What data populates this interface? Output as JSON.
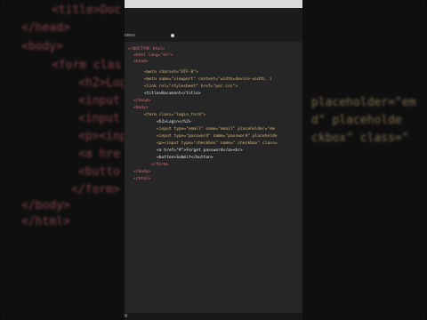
{
  "editor": {
    "tab_label": "ness",
    "status": "0",
    "code_lines": [
      "<!DOCTYPE html>",
      "<html lang=\"en\">",
      "<head>",
      "<meta charset=\"UTF-8\">",
      "<meta name=\"viewport\" content=\"width=device-width, i",
      "<link rel=\"stylesheet\" href=\"per.css\">",
      "<title>Document</title>",
      "</head>",
      "<body>",
      "<form class=\"login_form\">",
      "<h2>Login</h2>",
      "<input type=\"email\" name=\"email\" placeholder=\"em",
      "<input type=\"password\" name=\"password\" placeholde",
      "<p><input type=\"checkbox\" name=\" checkbox\" class=",
      "<a href=\"#\">Forget password</a><br>",
      "<button>Submit</button>",
      "</form>",
      "</body>",
      "</html>"
    ]
  },
  "background_left": [
    "<title>Doc",
    "</head>",
    "<body>",
    "<form clas",
    "<h2>Log",
    "<input",
    "<input",
    "<p><inp",
    "<a hre",
    "<butto",
    "</form>",
    "</body>",
    "</html>"
  ],
  "background_right": [
    "placeholder=\"em",
    "d\" placeholde",
    "ckbox\" class=\""
  ],
  "colors": {
    "tag": "#e06c75",
    "attribute": "#d7ba7d",
    "string": "#ce6aa8",
    "text": "#e8e8e8",
    "editor_bg": "#262626"
  }
}
